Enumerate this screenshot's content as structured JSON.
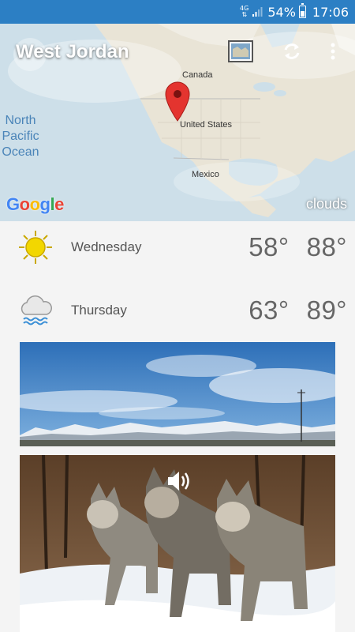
{
  "status_bar": {
    "network": "4G",
    "battery_percent": "54%",
    "time": "17:06"
  },
  "header": {
    "location_title": "West Jordan",
    "map_icon": "map-icon",
    "refresh_icon": "refresh-icon",
    "menu_icon": "more-vert-icon"
  },
  "map": {
    "labels": {
      "canada": "Canada",
      "united_states": "United States",
      "mexico": "Mexico",
      "ocean": "North Pacific Ocean"
    },
    "google_logo": "Google",
    "layer": "clouds"
  },
  "forecast": [
    {
      "day": "Wednesday",
      "low": "58°",
      "high": "88°",
      "icon": "sun-icon"
    },
    {
      "day": "Thursday",
      "low": "63°",
      "high": "89°",
      "icon": "rain-cloud-icon"
    }
  ],
  "photos": [
    {
      "name": "landscape-photo",
      "description_icon": "snowy-mountains"
    },
    {
      "name": "wolves-photo",
      "sound_icon": "speaker-icon"
    }
  ],
  "colors": {
    "status_bar": "#2c7fc4",
    "background": "#f4f4f4",
    "temp_text": "#666666",
    "sun": "#f2d700",
    "rain": "#3a8fd6"
  }
}
